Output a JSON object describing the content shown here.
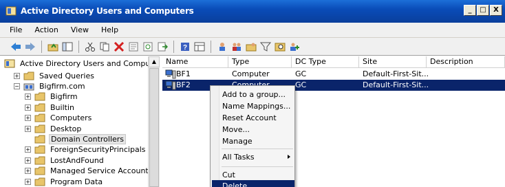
{
  "window": {
    "title": "Active Directory Users and Computers",
    "controls": [
      "_",
      "□",
      "X"
    ]
  },
  "menubar": {
    "items": [
      "File",
      "Action",
      "View",
      "Help"
    ]
  },
  "toolbar": {
    "icons": [
      "back-icon",
      "forward-icon",
      "up-folder-icon",
      "show-hide-tree-icon",
      "cut-icon",
      "copy-icon",
      "delete-icon",
      "properties-icon",
      "refresh-icon",
      "export-icon",
      "help-icon",
      "view-icon",
      "new-user-icon",
      "new-group-icon",
      "new-ou-icon",
      "filter-icon",
      "find-icon",
      "add-member-icon"
    ]
  },
  "tree": {
    "root": "Active Directory Users and Computers",
    "items": [
      {
        "label": "Saved Queries",
        "indent": 1,
        "expander": "+"
      },
      {
        "label": "Bigfirm.com",
        "indent": 1,
        "expander": "−"
      },
      {
        "label": "Bigfirm",
        "indent": 2,
        "expander": "+"
      },
      {
        "label": "Builtin",
        "indent": 2,
        "expander": "+"
      },
      {
        "label": "Computers",
        "indent": 2,
        "expander": "+"
      },
      {
        "label": "Desktop",
        "indent": 2,
        "expander": "+"
      },
      {
        "label": "Domain Controllers",
        "indent": 2,
        "expander": "",
        "selected": true
      },
      {
        "label": "ForeignSecurityPrincipals",
        "indent": 2,
        "expander": "+"
      },
      {
        "label": "LostAndFound",
        "indent": 2,
        "expander": "+"
      },
      {
        "label": "Managed Service Accounts",
        "indent": 2,
        "expander": "+"
      },
      {
        "label": "Program Data",
        "indent": 2,
        "expander": "+"
      }
    ]
  },
  "list": {
    "columns": [
      "Name",
      "Type",
      "DC Type",
      "Site",
      "Description"
    ],
    "rows": [
      {
        "name": "BF1",
        "type": "Computer",
        "dc_type": "GC",
        "site": "Default-First-Sit...",
        "description": "",
        "selected": false
      },
      {
        "name": "BF2",
        "type": "Computer",
        "dc_type": "GC",
        "site": "Default-First-Sit...",
        "description": "",
        "selected": true
      }
    ]
  },
  "context_menu": {
    "items": [
      {
        "label": "Add to a group..."
      },
      {
        "label": "Name Mappings..."
      },
      {
        "label": "Reset Account"
      },
      {
        "label": "Move..."
      },
      {
        "label": "Manage"
      },
      {
        "label": "All Tasks",
        "submenu": true
      },
      {
        "label": "Cut"
      },
      {
        "label": "Delete",
        "highlighted": true
      }
    ]
  },
  "colors": {
    "selection": "#0a246a",
    "titlebar": "#0a4cb8",
    "folder": "#e8c56a"
  }
}
